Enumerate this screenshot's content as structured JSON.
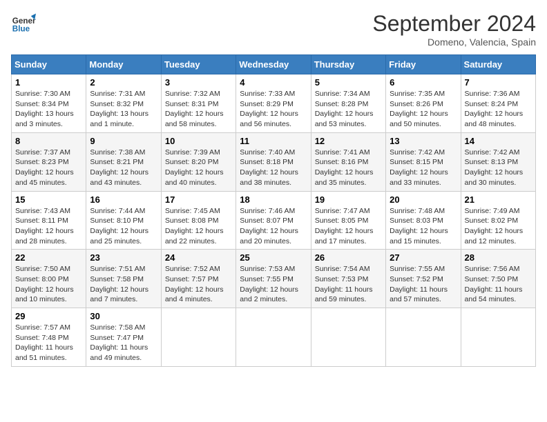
{
  "header": {
    "logo_text_general": "General",
    "logo_text_blue": "Blue",
    "month": "September 2024",
    "location": "Domeno, Valencia, Spain"
  },
  "weekdays": [
    "Sunday",
    "Monday",
    "Tuesday",
    "Wednesday",
    "Thursday",
    "Friday",
    "Saturday"
  ],
  "weeks": [
    [
      {
        "day": 1,
        "sunrise": "7:30 AM",
        "sunset": "8:34 PM",
        "daylight": "13 hours and 3 minutes."
      },
      {
        "day": 2,
        "sunrise": "7:31 AM",
        "sunset": "8:32 PM",
        "daylight": "13 hours and 1 minute."
      },
      {
        "day": 3,
        "sunrise": "7:32 AM",
        "sunset": "8:31 PM",
        "daylight": "12 hours and 58 minutes."
      },
      {
        "day": 4,
        "sunrise": "7:33 AM",
        "sunset": "8:29 PM",
        "daylight": "12 hours and 56 minutes."
      },
      {
        "day": 5,
        "sunrise": "7:34 AM",
        "sunset": "8:28 PM",
        "daylight": "12 hours and 53 minutes."
      },
      {
        "day": 6,
        "sunrise": "7:35 AM",
        "sunset": "8:26 PM",
        "daylight": "12 hours and 50 minutes."
      },
      {
        "day": 7,
        "sunrise": "7:36 AM",
        "sunset": "8:24 PM",
        "daylight": "12 hours and 48 minutes."
      }
    ],
    [
      {
        "day": 8,
        "sunrise": "7:37 AM",
        "sunset": "8:23 PM",
        "daylight": "12 hours and 45 minutes."
      },
      {
        "day": 9,
        "sunrise": "7:38 AM",
        "sunset": "8:21 PM",
        "daylight": "12 hours and 43 minutes."
      },
      {
        "day": 10,
        "sunrise": "7:39 AM",
        "sunset": "8:20 PM",
        "daylight": "12 hours and 40 minutes."
      },
      {
        "day": 11,
        "sunrise": "7:40 AM",
        "sunset": "8:18 PM",
        "daylight": "12 hours and 38 minutes."
      },
      {
        "day": 12,
        "sunrise": "7:41 AM",
        "sunset": "8:16 PM",
        "daylight": "12 hours and 35 minutes."
      },
      {
        "day": 13,
        "sunrise": "7:42 AM",
        "sunset": "8:15 PM",
        "daylight": "12 hours and 33 minutes."
      },
      {
        "day": 14,
        "sunrise": "7:42 AM",
        "sunset": "8:13 PM",
        "daylight": "12 hours and 30 minutes."
      }
    ],
    [
      {
        "day": 15,
        "sunrise": "7:43 AM",
        "sunset": "8:11 PM",
        "daylight": "12 hours and 28 minutes."
      },
      {
        "day": 16,
        "sunrise": "7:44 AM",
        "sunset": "8:10 PM",
        "daylight": "12 hours and 25 minutes."
      },
      {
        "day": 17,
        "sunrise": "7:45 AM",
        "sunset": "8:08 PM",
        "daylight": "12 hours and 22 minutes."
      },
      {
        "day": 18,
        "sunrise": "7:46 AM",
        "sunset": "8:07 PM",
        "daylight": "12 hours and 20 minutes."
      },
      {
        "day": 19,
        "sunrise": "7:47 AM",
        "sunset": "8:05 PM",
        "daylight": "12 hours and 17 minutes."
      },
      {
        "day": 20,
        "sunrise": "7:48 AM",
        "sunset": "8:03 PM",
        "daylight": "12 hours and 15 minutes."
      },
      {
        "day": 21,
        "sunrise": "7:49 AM",
        "sunset": "8:02 PM",
        "daylight": "12 hours and 12 minutes."
      }
    ],
    [
      {
        "day": 22,
        "sunrise": "7:50 AM",
        "sunset": "8:00 PM",
        "daylight": "12 hours and 10 minutes."
      },
      {
        "day": 23,
        "sunrise": "7:51 AM",
        "sunset": "7:58 PM",
        "daylight": "12 hours and 7 minutes."
      },
      {
        "day": 24,
        "sunrise": "7:52 AM",
        "sunset": "7:57 PM",
        "daylight": "12 hours and 4 minutes."
      },
      {
        "day": 25,
        "sunrise": "7:53 AM",
        "sunset": "7:55 PM",
        "daylight": "12 hours and 2 minutes."
      },
      {
        "day": 26,
        "sunrise": "7:54 AM",
        "sunset": "7:53 PM",
        "daylight": "11 hours and 59 minutes."
      },
      {
        "day": 27,
        "sunrise": "7:55 AM",
        "sunset": "7:52 PM",
        "daylight": "11 hours and 57 minutes."
      },
      {
        "day": 28,
        "sunrise": "7:56 AM",
        "sunset": "7:50 PM",
        "daylight": "11 hours and 54 minutes."
      }
    ],
    [
      {
        "day": 29,
        "sunrise": "7:57 AM",
        "sunset": "7:48 PM",
        "daylight": "11 hours and 51 minutes."
      },
      {
        "day": 30,
        "sunrise": "7:58 AM",
        "sunset": "7:47 PM",
        "daylight": "11 hours and 49 minutes."
      },
      null,
      null,
      null,
      null,
      null
    ]
  ]
}
